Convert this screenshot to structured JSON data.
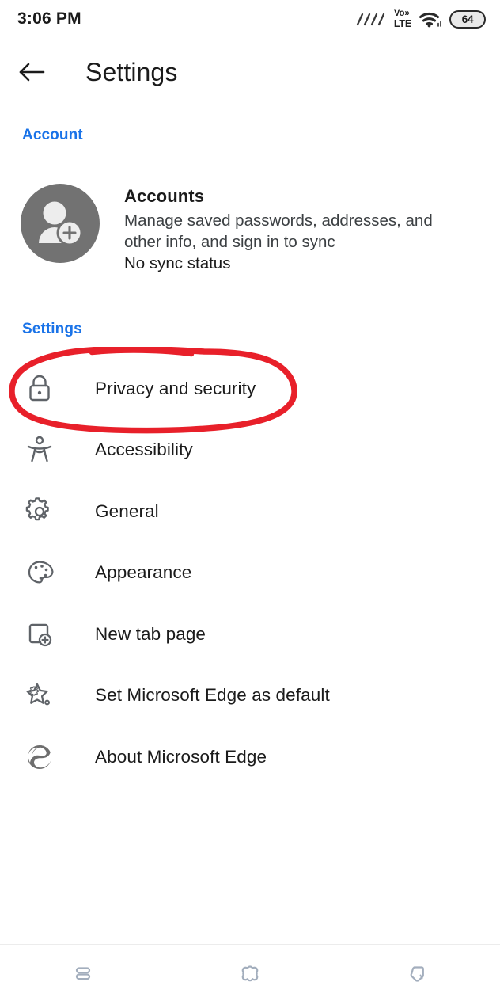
{
  "statusbar": {
    "time": "3:06 PM",
    "signal_icon": "signal-bars-icon",
    "network_line1": "Vo»",
    "network_line2": "LTE",
    "wifi_icon": "wifi-icon",
    "battery_level": "64"
  },
  "header": {
    "back_icon": "back-arrow-icon",
    "title": "Settings"
  },
  "sections": {
    "account_label": "Account",
    "settings_label": "Settings"
  },
  "account": {
    "avatar_icon": "person-add-avatar-icon",
    "title": "Accounts",
    "description": "Manage saved passwords, addresses, and other info, and sign in to sync",
    "sync_status": "No sync status"
  },
  "settings_items": [
    {
      "label": "Privacy and security",
      "icon": "lock-icon",
      "highlighted": true
    },
    {
      "label": "Accessibility",
      "icon": "accessibility-person-icon",
      "highlighted": false
    },
    {
      "label": "General",
      "icon": "gear-icon",
      "highlighted": false
    },
    {
      "label": "Appearance",
      "icon": "palette-icon",
      "highlighted": false
    },
    {
      "label": "New tab page",
      "icon": "new-tab-page-icon",
      "highlighted": false
    },
    {
      "label": "Set Microsoft Edge as default",
      "icon": "star-gear-icon",
      "highlighted": false
    },
    {
      "label": "About Microsoft Edge",
      "icon": "edge-logo-icon",
      "highlighted": false
    }
  ],
  "annotation": {
    "shape": "hand-drawn-ellipse",
    "target": "Privacy and security",
    "color": "#e8202a"
  },
  "navbar": {
    "recents_icon": "recents-icon",
    "home_icon": "home-icon",
    "back_icon": "nav-back-icon"
  },
  "colors": {
    "accent_blue": "#1a73e8",
    "text_primary": "#1b1b1b",
    "text_secondary": "#3c4043",
    "icon_gray": "#5f6368",
    "avatar_gray": "#727272",
    "annotation_red": "#e8202a",
    "nav_icon": "#a3aebd"
  }
}
